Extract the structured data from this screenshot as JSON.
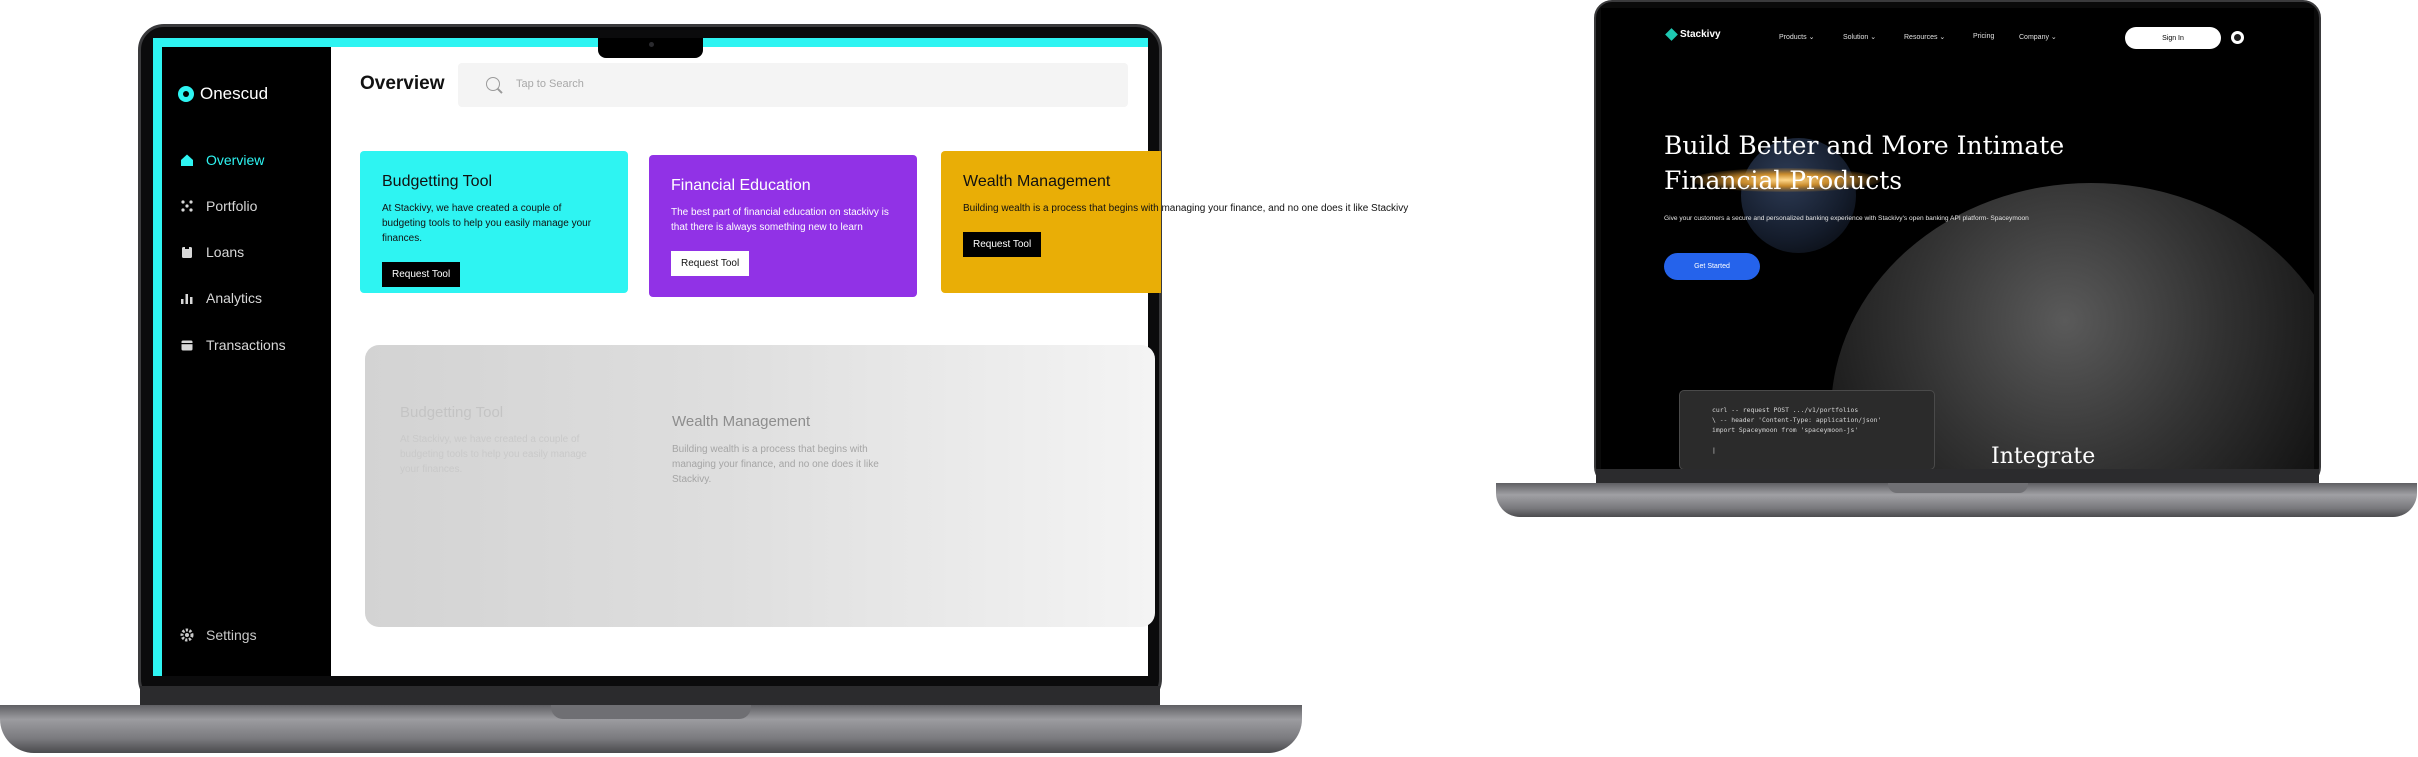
{
  "dashboard": {
    "brand": "Onescud",
    "page_title": "Overview",
    "search_placeholder": "Tap to Search",
    "nav": [
      {
        "label": "Overview",
        "icon": "home-icon",
        "active": true
      },
      {
        "label": "Portfolio",
        "icon": "portfolio-icon"
      },
      {
        "label": "Loans",
        "icon": "loans-icon"
      },
      {
        "label": "Analytics",
        "icon": "analytics-icon"
      },
      {
        "label": "Transactions",
        "icon": "transactions-icon"
      }
    ],
    "settings_label": "Settings",
    "cards": [
      {
        "title": "Budgetting Tool",
        "body": "At Stackivy, we have created a couple of budgeting tools to help you easily manage your finances.",
        "button": "Request Tool",
        "color": "#2ef4f2"
      },
      {
        "title": "Financial Education",
        "body": "The best part of financial education on stackivy is that there is always something new to learn",
        "button": "Request Tool",
        "color": "#9132e6"
      },
      {
        "title": "Wealth Management",
        "body": "Building wealth is a process that begins with managing your finance, and no one does it like Stackivy",
        "button": "Request Tool",
        "color": "#e9ae06"
      }
    ],
    "ghost": [
      {
        "title": "Budgetting Tool",
        "body": "At Stackivy, we have created a couple of budgeting tools to help you easily manage your finances."
      },
      {
        "title": "Wealth Management",
        "body": "Building wealth is a process that begins with managing your finance, and no one does it like Stackivy."
      }
    ]
  },
  "landing": {
    "brand": "Stackivy",
    "nav": [
      "Products",
      "Solution",
      "Resources",
      "Pricing",
      "Company"
    ],
    "sign_in": "Sign In",
    "headline_line1": "Build Better and More Intimate",
    "headline_line2": "Financial Products",
    "subtext": "Give your customers a secure and personalized banking experience with Stackivy's open banking API platform- Spaceymoon",
    "cta": "Get Started",
    "code_lines": [
      "curl -- request POST .../v1/portfolios",
      " \\ -- header 'Content-Type: application/json'",
      "import Spaceymoon from 'spaceymoon-js'",
      "",
      "|"
    ],
    "section_peek": "Integrate"
  }
}
